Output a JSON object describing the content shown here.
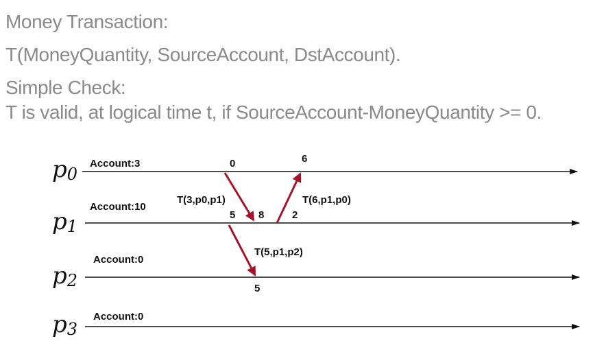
{
  "text": {
    "line1": "Money Transaction:",
    "line2": "T(MoneyQuantity, SourceAccount, DstAccount).",
    "line3": "Simple Check:",
    "line4": "T is valid, at logical time t, if SourceAccount-MoneyQuantity >= 0."
  },
  "processes": [
    {
      "name": "p",
      "sub": "0",
      "account": "Account:3"
    },
    {
      "name": "p",
      "sub": "1",
      "account": "Account:10"
    },
    {
      "name": "p",
      "sub": "2",
      "account": "Account:0"
    },
    {
      "name": "p",
      "sub": "3",
      "account": "Account:0"
    }
  ],
  "messages": [
    {
      "label": "T(3,p0,p1)",
      "send_time": "0",
      "recv_time": "8"
    },
    {
      "label": "T(6,p1,p0)",
      "send_time": "2",
      "recv_time": "6"
    },
    {
      "label": "T(5,p1,p2)",
      "send_time": "5",
      "recv_time": "5"
    }
  ],
  "colors": {
    "heading_text": "#8a8a8a",
    "timeline": "#111111",
    "message_arrow": "#a3152a"
  }
}
